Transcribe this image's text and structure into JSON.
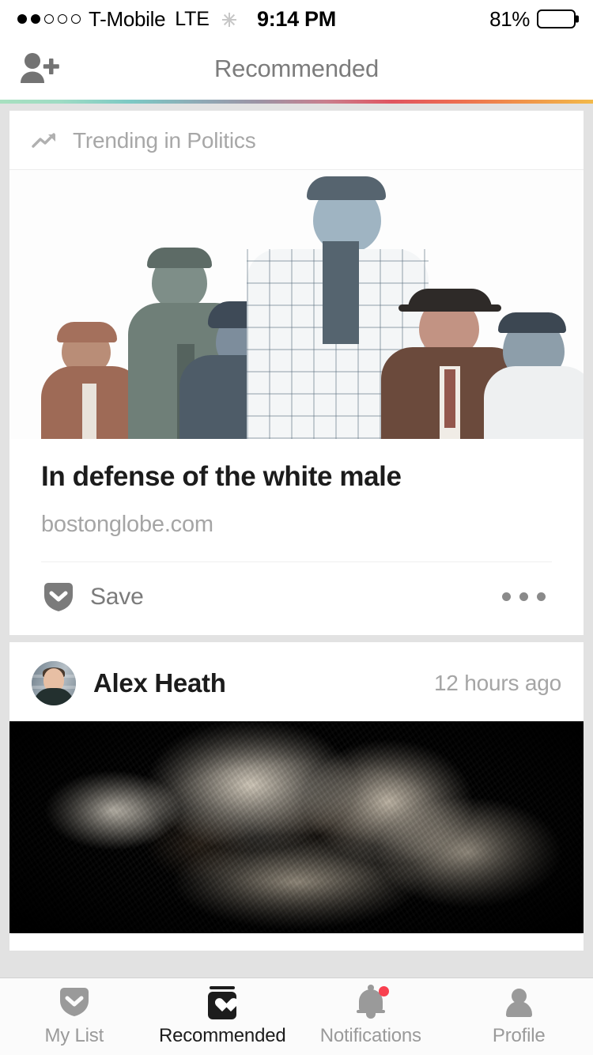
{
  "status_bar": {
    "signal_dots_total": 5,
    "signal_dots_filled": 2,
    "carrier": "T-Mobile",
    "network": "LTE",
    "activity_icon": "spinner-icon",
    "time": "9:14 PM",
    "battery_percent": "81%",
    "battery_level": 81
  },
  "header": {
    "add_friend_icon": "add-person-icon",
    "title": "Recommended",
    "accent_gradient": [
      "#a8e0c0",
      "#7dc9c4",
      "#9d93a4",
      "#e05561",
      "#f2b949"
    ]
  },
  "feed": {
    "trending_card": {
      "trending_icon": "trending-up-icon",
      "trending_label": "Trending in Politics",
      "article_title": "In defense of the white male",
      "article_source": "bostonglobe.com",
      "save_icon": "pocket-save-icon",
      "save_label": "Save",
      "more_icon": "more-options-icon"
    },
    "post_card": {
      "avatar": "user-avatar",
      "author": "Alex Heath",
      "timestamp": "12 hours ago"
    }
  },
  "tab_bar": {
    "tabs": [
      {
        "label": "My List",
        "icon": "pocket-list-icon",
        "active": false,
        "badge": false
      },
      {
        "label": "Recommended",
        "icon": "recommended-heart-icon",
        "active": true,
        "badge": false
      },
      {
        "label": "Notifications",
        "icon": "bell-icon",
        "active": false,
        "badge": true
      },
      {
        "label": "Profile",
        "icon": "person-icon",
        "active": false,
        "badge": false
      }
    ],
    "badge_color": "#f8404f"
  }
}
